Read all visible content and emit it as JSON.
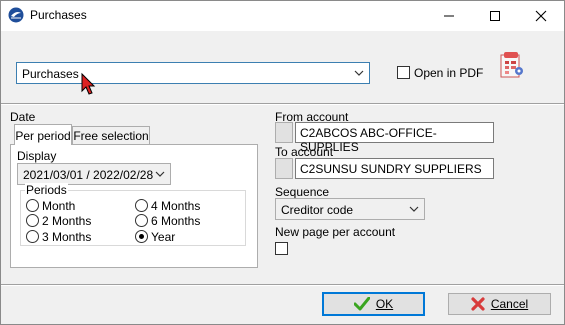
{
  "window": {
    "title": "Purchases",
    "icons": {
      "app": "app-logo-icon",
      "minimize": "minimize-icon",
      "maximize": "maximize-icon",
      "close": "close-icon"
    }
  },
  "top": {
    "report_select": {
      "value": "Purchases"
    },
    "open_in_pdf": {
      "label": "Open in PDF",
      "checked": false
    },
    "report_icon": "report-settings-icon"
  },
  "date": {
    "label": "Date",
    "tabs": [
      {
        "label": "Per period",
        "active": true
      },
      {
        "label": "Free selection",
        "active": false
      }
    ],
    "display_label": "Display",
    "display_value": "2021/03/01 / 2022/02/28",
    "periods_label": "Periods",
    "periods": [
      {
        "label": "Month",
        "selected": false
      },
      {
        "label": "4 Months",
        "selected": false
      },
      {
        "label": "2 Months",
        "selected": false
      },
      {
        "label": "6 Months",
        "selected": false
      },
      {
        "label": "3 Months",
        "selected": false
      },
      {
        "label": "Year",
        "selected": true
      }
    ]
  },
  "accounts": {
    "from_label": "From account",
    "from_value": "C2ABCOS ABC-OFFICE-SUPPLIES",
    "to_label": "To account",
    "to_value": "C2SUNSU SUNDRY SUPPLIERS",
    "sequence_label": "Sequence",
    "sequence_value": "Creditor code",
    "new_page_label": "New page per account",
    "new_page_checked": false
  },
  "buttons": {
    "ok": "OK",
    "cancel": "Cancel"
  },
  "colors": {
    "accent": "#0078d7",
    "ok_check": "#3aa520",
    "cancel_x": "#d83b3b"
  }
}
